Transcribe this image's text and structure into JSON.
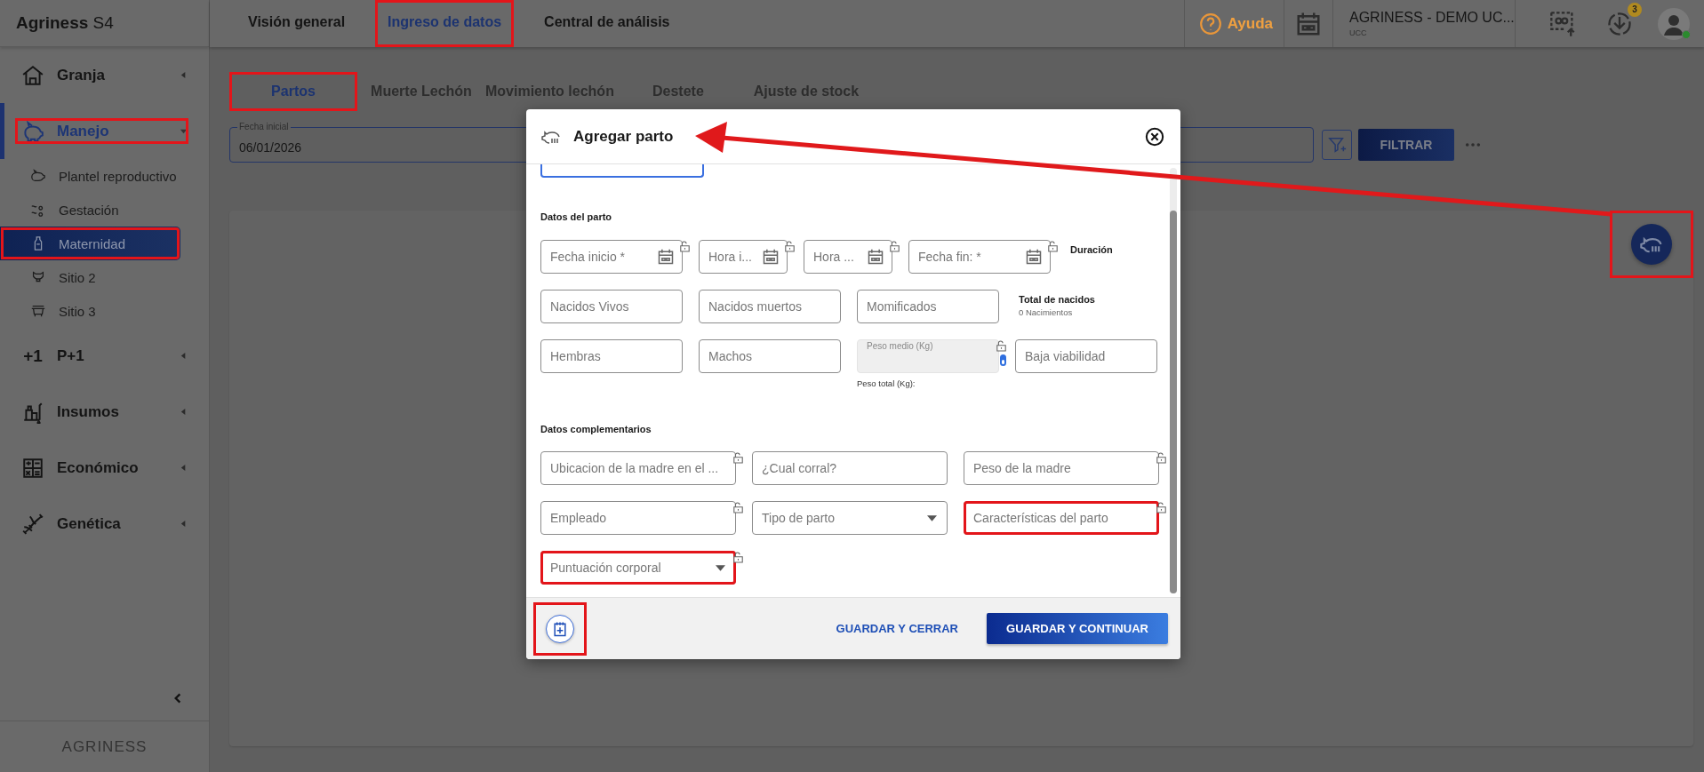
{
  "brand": "**Agriness** S4",
  "sidebar": {
    "items": [
      {
        "label": "Granja",
        "selected": false,
        "expanded": false,
        "highlighted": false
      },
      {
        "label": "Manejo",
        "selected": true,
        "expanded": true,
        "highlighted": true,
        "children": [
          {
            "label": "Plantel reproductivo",
            "selected": false,
            "highlighted": false
          },
          {
            "label": "Gestación",
            "selected": false,
            "highlighted": false
          },
          {
            "label": "Maternidad",
            "selected": true,
            "highlighted": true
          },
          {
            "label": "Sitio 2",
            "selected": false,
            "highlighted": false
          },
          {
            "label": "Sitio 3",
            "selected": false,
            "highlighted": false
          }
        ]
      },
      {
        "label": "P+1",
        "icon_text": "+1",
        "selected": false,
        "expanded": false,
        "highlighted": false
      },
      {
        "label": "Insumos",
        "selected": false,
        "expanded": false,
        "highlighted": false
      },
      {
        "label": "Económico",
        "selected": false,
        "expanded": false,
        "highlighted": false
      },
      {
        "label": "Genética",
        "selected": false,
        "expanded": false,
        "highlighted": false
      }
    ],
    "footer_logo": "AGRINESS"
  },
  "top_tabs": [
    {
      "label": "Visión general",
      "selected": false,
      "highlighted": false
    },
    {
      "label": "Ingreso de datos",
      "selected": true,
      "highlighted": true
    },
    {
      "label": "Central de análisis",
      "selected": false,
      "highlighted": false
    }
  ],
  "header": {
    "help": "Ayuda",
    "farm": "AGRINESS - DEMO UC...",
    "farm_code": "UCC",
    "downloads_badge": "3",
    "user_online": true
  },
  "sub_tabs": [
    {
      "label": "Partos",
      "selected": true,
      "highlighted": true
    },
    {
      "label": "Muerte Lechón",
      "selected": false,
      "highlighted": false
    },
    {
      "label": "Movimiento lechón",
      "selected": false,
      "highlighted": false
    },
    {
      "label": "Destete",
      "selected": false,
      "highlighted": false
    },
    {
      "label": "Ajuste de stock",
      "selected": false,
      "highlighted": false
    }
  ],
  "filter": {
    "label": "Fecha inicial",
    "value": "06/01/2026",
    "button": "FILTRAR"
  },
  "fab": {
    "highlighted": true
  },
  "modal": {
    "title": "Agregar parto",
    "sections": [
      {
        "title": "Datos del parto",
        "rows": [
          {
            "fields": [
              {
                "placeholder": "Fecha inicio *",
                "kind": "date",
                "lockable": true,
                "highlighted": false
              },
              {
                "placeholder": "Hora i...",
                "kind": "time",
                "lockable": true,
                "highlighted": false
              },
              {
                "placeholder": "Hora ...",
                "kind": "time",
                "lockable": true,
                "highlighted": false
              },
              {
                "placeholder": "Fecha fin: *",
                "kind": "date",
                "lockable": true,
                "highlighted": false
              }
            ],
            "aside_title": "Duración"
          },
          {
            "fields": [
              {
                "placeholder": "Nacidos Vivos",
                "kind": "text",
                "lockable": false,
                "highlighted": false
              },
              {
                "placeholder": "Nacidos muertos",
                "kind": "text",
                "lockable": false,
                "highlighted": false
              },
              {
                "placeholder": "Momificados",
                "kind": "text",
                "lockable": false,
                "highlighted": false
              }
            ],
            "aside_title": "Total de nacidos",
            "aside_text": "0 Nacimientos"
          },
          {
            "fields": [
              {
                "placeholder": "Hembras",
                "kind": "text",
                "lockable": false,
                "highlighted": false
              },
              {
                "placeholder": "Machos",
                "kind": "text",
                "lockable": false,
                "highlighted": false
              },
              {
                "label": "Peso medio (Kg)",
                "kind": "computed",
                "disabled": true,
                "toggle_on": true,
                "lockable": true,
                "caption": "Peso total (Kg):",
                "highlighted": false
              },
              {
                "placeholder": "Baja viabilidad",
                "kind": "text",
                "lockable": false,
                "highlighted": false
              }
            ]
          }
        ]
      },
      {
        "title": "Datos complementarios",
        "fields": [
          {
            "placeholder": "Ubicacion de la madre en el ...",
            "kind": "text",
            "lockable": true,
            "highlighted": false
          },
          {
            "placeholder": "¿Cual corral?",
            "kind": "text",
            "lockable": false,
            "highlighted": false
          },
          {
            "placeholder": "Peso de la madre",
            "kind": "text",
            "lockable": true,
            "highlighted": false
          },
          {
            "placeholder": "Empleado",
            "kind": "text",
            "lockable": true,
            "highlighted": false
          },
          {
            "placeholder": "Tipo de parto",
            "kind": "select",
            "lockable": false,
            "highlighted": false
          },
          {
            "placeholder": "Características del parto",
            "kind": "text",
            "lockable": true,
            "highlighted": true
          },
          {
            "placeholder": "Puntuación corporal",
            "kind": "select",
            "lockable": true,
            "highlighted": true
          }
        ]
      }
    ],
    "footer": {
      "add_note_highlighted": true,
      "buttons": [
        {
          "label": "GUARDAR Y CERRAR",
          "kind": "text"
        },
        {
          "label": "GUARDAR Y CONTINUAR",
          "kind": "primary"
        }
      ]
    }
  }
}
